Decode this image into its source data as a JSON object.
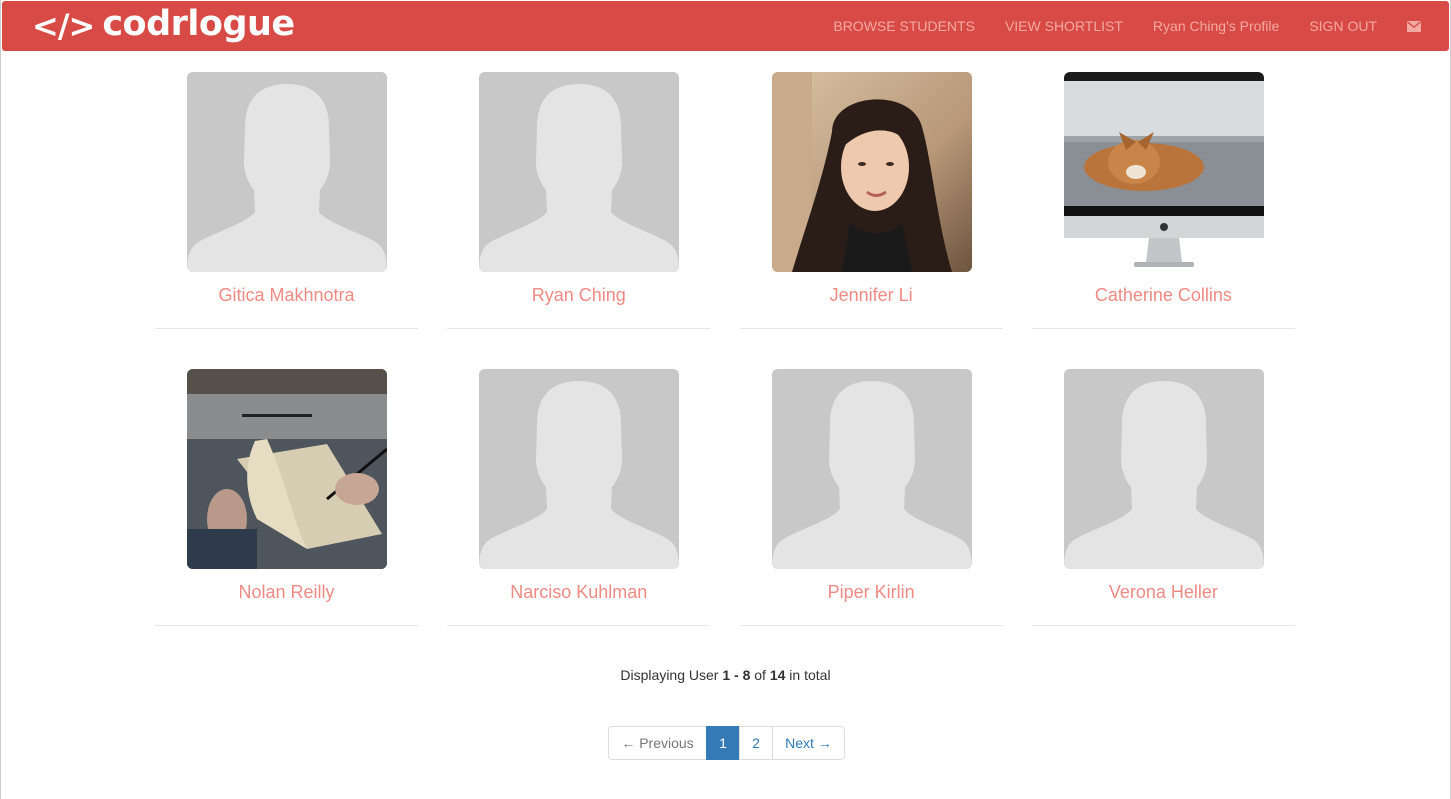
{
  "app": {
    "brand_code": "</>",
    "brand_name": "codrlogue"
  },
  "nav": {
    "browse": "BROWSE STUDENTS",
    "shortlist": "VIEW SHORTLIST",
    "profile": "Ryan Ching's Profile",
    "signout": "SIGN OUT",
    "mail_icon": "envelope-icon"
  },
  "students": [
    {
      "name": "Gitica Makhnotra",
      "photo": "default-avatar"
    },
    {
      "name": "Ryan Ching",
      "photo": "default-avatar"
    },
    {
      "name": "Jennifer Li",
      "photo": "portrait-woman"
    },
    {
      "name": "Catherine Collins",
      "photo": "dog-on-imac"
    },
    {
      "name": "Nolan Reilly",
      "photo": "hands-writing-notebook"
    },
    {
      "name": "Narciso Kuhlman",
      "photo": "default-avatar"
    },
    {
      "name": "Piper Kirlin",
      "photo": "default-avatar"
    },
    {
      "name": "Verona Heller",
      "photo": "default-avatar"
    }
  ],
  "summary": {
    "prefix": "Displaying User ",
    "range": "1 - 8",
    "of": " of ",
    "total": "14",
    "suffix": " in total"
  },
  "pagination": {
    "previous": "← Previous",
    "pages": [
      "1",
      "2"
    ],
    "active_page": "1",
    "next": "Next →"
  },
  "colors": {
    "navbar": "#d84a46",
    "nav_link": "#f2a9a2",
    "student_name": "#ef8a84",
    "page_active": "#337ab7"
  }
}
